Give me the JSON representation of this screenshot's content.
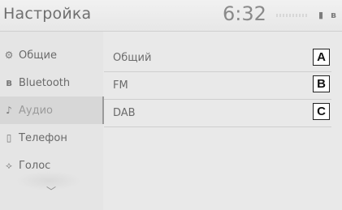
{
  "header": {
    "title": "Настройка",
    "clock": "6:32",
    "status_icons": [
      "phone-battery-icon",
      "bluetooth-icon"
    ]
  },
  "sidebar": {
    "items": [
      {
        "label": "Общие",
        "icon": "gear-icon",
        "glyph": "⚙",
        "active": false
      },
      {
        "label": "Bluetooth",
        "icon": "bluetooth-icon",
        "glyph": "ʙ",
        "active": false
      },
      {
        "label": "Аудио",
        "icon": "music-note-icon",
        "glyph": "♪",
        "active": true
      },
      {
        "label": "Телефон",
        "icon": "phone-icon",
        "glyph": "▯",
        "active": false
      },
      {
        "label": "Голос",
        "icon": "voice-icon",
        "glyph": "⟡",
        "active": false
      }
    ],
    "more_icon": "chevron-down-icon"
  },
  "main": {
    "items": [
      {
        "label": "Общий",
        "callout": "A"
      },
      {
        "label": "FM",
        "callout": "B"
      },
      {
        "label": "DAB",
        "callout": "C"
      }
    ]
  },
  "colors": {
    "background": "#e9e9e9",
    "active_item": "#d7d7d7",
    "text": "#6c6c6c",
    "callout_border": "#222222"
  }
}
